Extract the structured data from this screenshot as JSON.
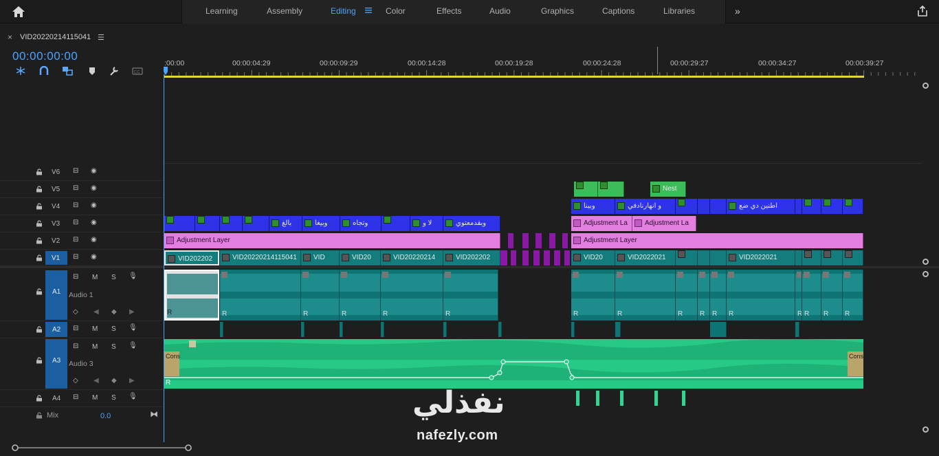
{
  "workspace": {
    "tabs": [
      "Learning",
      "Assembly",
      "Editing",
      "Color",
      "Effects",
      "Audio",
      "Graphics",
      "Captions",
      "Libraries"
    ],
    "active": "Editing"
  },
  "sequence": {
    "name": "VID20220214115041",
    "timecode": "00:00:00:00"
  },
  "ruler": {
    "labels": [
      ":00:00",
      "00:00:04:29",
      "00:00:09:29",
      "00:00:14:28",
      "00:00:19:28",
      "00:00:24:28",
      "00:00:29:27",
      "00:00:34:27",
      "00:00:39:27"
    ]
  },
  "tracks": {
    "video": [
      {
        "name": "V6"
      },
      {
        "name": "V5"
      },
      {
        "name": "V4"
      },
      {
        "name": "V3"
      },
      {
        "name": "V2"
      },
      {
        "name": "V1"
      }
    ],
    "audio": [
      {
        "name": "A1",
        "label": "Audio 1"
      },
      {
        "name": "A2",
        "label": ""
      },
      {
        "name": "A3",
        "label": "Audio 3"
      },
      {
        "name": "A4",
        "label": ""
      }
    ],
    "mix": {
      "label": "Mix",
      "value": "0.0"
    },
    "buttons": {
      "mute": "M",
      "solo": "S"
    }
  },
  "clips": {
    "v5": [
      "",
      "",
      "Nest"
    ],
    "v4": [
      "وبينا",
      "و انهارنادفي",
      "اطنين دي ضع"
    ],
    "v3": [
      "بالغ",
      "وبيغا",
      "وتجاه",
      "لا و",
      "وبقدمعتوي"
    ],
    "v2_adjustment": "Adjustment Layer",
    "v3_adjustment": "Adjustment La",
    "v1": [
      "VID202202",
      "VID20220214115041",
      "VID",
      "VID20",
      "VID20220214",
      "VID202202",
      "VID20",
      "VID2022021",
      "VID2022021"
    ],
    "a3_clip": "Cons",
    "audio_marker": "R"
  },
  "watermark": {
    "arabic": "نفذلي",
    "latin": "nafezly.com"
  }
}
